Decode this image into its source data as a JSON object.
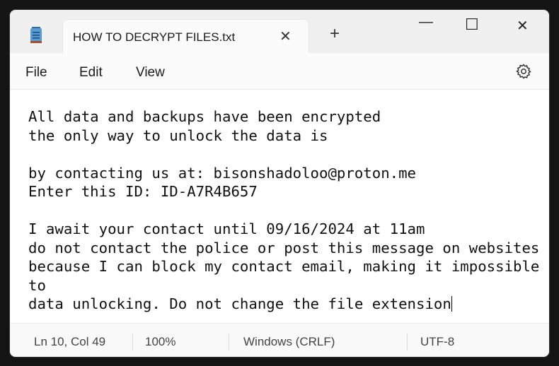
{
  "window": {
    "tab_title": "HOW TO DECRYPT FILES.txt",
    "app_icon": "notepad-icon",
    "controls": {
      "minimize": "—",
      "maximize": "☐",
      "close": "✕",
      "new_tab": "+",
      "tab_close": "✕"
    }
  },
  "menu": {
    "items": [
      "File",
      "Edit",
      "View"
    ],
    "settings_icon": "gear-icon"
  },
  "editor": {
    "content": "All data and backups have been encrypted\nthe only way to unlock the data is\n\nby contacting us at: bisonshadoloo@proton.me\nEnter this ID: ID-A7R4B657\n\nI await your contact until 09/16/2024 at 11am\ndo not contact the police or post this message on websites\nbecause I can block my contact email, making it impossible\nto\ndata unlocking. Do not change the file extension"
  },
  "status": {
    "position": "Ln 10, Col 49",
    "zoom": "100%",
    "line_ending": "Windows (CRLF)",
    "encoding": "UTF-8"
  }
}
